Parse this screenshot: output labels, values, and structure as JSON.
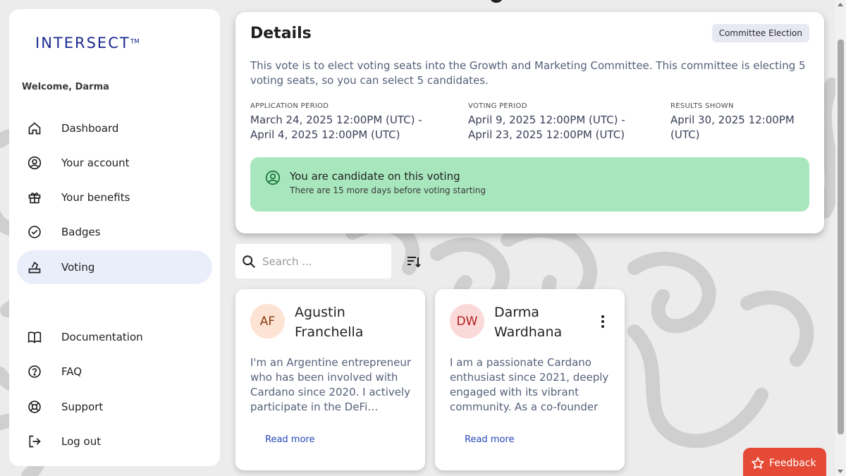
{
  "brand": {
    "logo_text": "INTERSECT",
    "logo_tm": "TM"
  },
  "sidebar": {
    "welcome": "Welcome, Darma",
    "items": [
      {
        "label": "Dashboard",
        "icon": "home-icon"
      },
      {
        "label": "Your account",
        "icon": "user-circle-icon"
      },
      {
        "label": "Your benefits",
        "icon": "gift-icon"
      },
      {
        "label": "Badges",
        "icon": "check-badge-icon"
      },
      {
        "label": "Voting",
        "icon": "vote-icon",
        "active": true
      }
    ],
    "footer_items": [
      {
        "label": "Documentation",
        "icon": "book-icon"
      },
      {
        "label": "FAQ",
        "icon": "question-icon"
      },
      {
        "label": "Support",
        "icon": "lifebuoy-icon"
      },
      {
        "label": "Log out",
        "icon": "logout-icon"
      }
    ]
  },
  "details": {
    "title": "Details",
    "badge": "Committee Election",
    "description": "This vote is to elect voting seats into the Growth and Marketing Committee. This committee is electing 5 voting seats, so you can select 5 candidates.",
    "periods": [
      {
        "label": "APPLICATION PERIOD",
        "line1": "March 24, 2025 12:00PM (UTC) -",
        "line2": "April 4, 2025 12:00PM (UTC)"
      },
      {
        "label": "VOTING PERIOD",
        "line1": "April 9, 2025 12:00PM (UTC) -",
        "line2": "April 23, 2025 12:00PM (UTC)"
      },
      {
        "label": "RESULTS SHOWN",
        "line1": "April 30, 2025 12:00PM (UTC)",
        "line2": ""
      }
    ],
    "alert": {
      "title": "You are candidate on this voting",
      "subtitle": "There are 15 more days before voting starting"
    }
  },
  "search": {
    "placeholder": "Search ..."
  },
  "candidates": [
    {
      "initials": "AF",
      "name": "Agustin Franchella",
      "bio": "I'm an Argentine entrepreneur who has been involved with Cardano since 2020. I actively participate in the DeFi…",
      "read_more": "Read more",
      "avatar_bg": "#fde3d3",
      "avatar_fg": "#8a3b12"
    },
    {
      "initials": "DW",
      "name": "Darma Wardhana",
      "bio": "I am a passionate Cardano enthusiast since 2021, deeply engaged with its vibrant community. As a co-founder …",
      "read_more": "Read more",
      "avatar_bg": "#fbd9d9",
      "avatar_fg": "#b21e1e"
    }
  ],
  "feedback": {
    "label": "Feedback"
  },
  "colors": {
    "accent": "#2446b8",
    "alert_bg": "#a8e6bd",
    "feedback_bg": "#e44a35",
    "active_nav": "#eaeefb"
  }
}
